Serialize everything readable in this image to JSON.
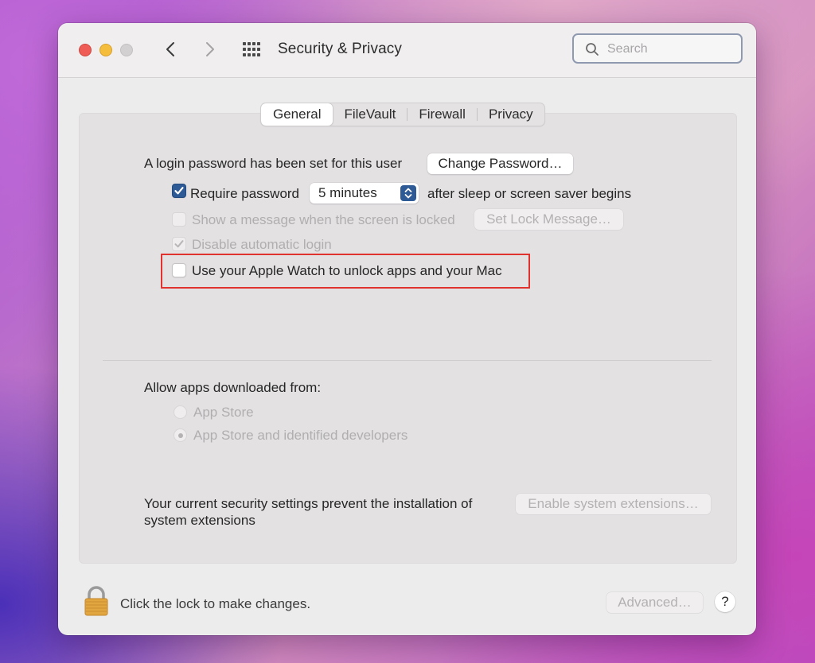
{
  "window": {
    "title": "Security & Privacy",
    "search_placeholder": "Search"
  },
  "tabs": [
    {
      "label": "General",
      "selected": true
    },
    {
      "label": "FileVault",
      "selected": false
    },
    {
      "label": "Firewall",
      "selected": false
    },
    {
      "label": "Privacy",
      "selected": false
    }
  ],
  "general": {
    "login_text": "A login password has been set for this user",
    "change_password_label": "Change Password…",
    "require_password": {
      "label": "Require password",
      "checked": true
    },
    "require_password_delay": "5 minutes",
    "after_sleep_text": "after sleep or screen saver begins",
    "show_message": {
      "label": "Show a message when the screen is locked",
      "checked": false,
      "enabled": false
    },
    "set_lock_message_label": "Set Lock Message…",
    "disable_auto_login": {
      "label": "Disable automatic login",
      "checked": true,
      "enabled": false
    },
    "apple_watch": {
      "label": "Use your Apple Watch to unlock apps and your Mac",
      "checked": false
    },
    "allow_apps_label": "Allow apps downloaded from:",
    "radio_options": [
      {
        "label": "App Store",
        "selected": false
      },
      {
        "label": "App Store and identified developers",
        "selected": true
      }
    ],
    "extensions_text_line1": "Your current security settings prevent the installation of",
    "extensions_text_line2": "system extensions",
    "enable_extensions_label": "Enable system extensions…"
  },
  "footer": {
    "lock_text": "Click the lock to make changes.",
    "advanced_label": "Advanced…",
    "help_label": "?"
  },
  "colors": {
    "accent": "#2e5a95",
    "highlight_border": "#e0322e",
    "close": "#ee5c55",
    "minimize": "#f5bd3c"
  }
}
